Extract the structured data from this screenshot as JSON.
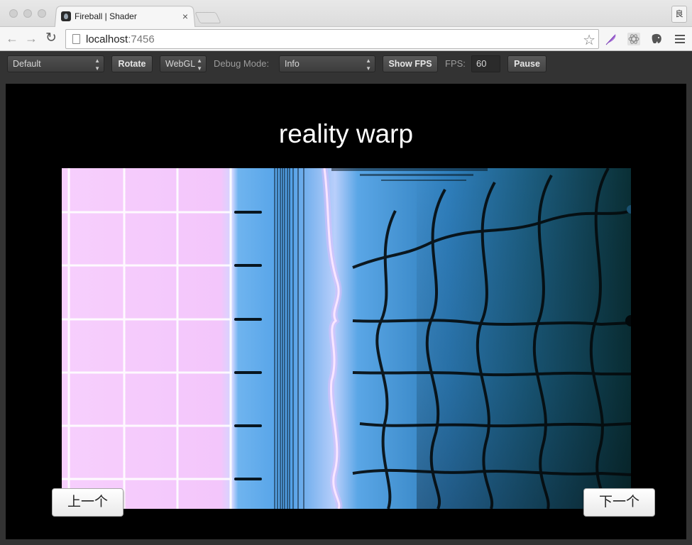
{
  "browser": {
    "tab_title": "Fireball | Shader",
    "tab_close": "×",
    "profile_label": "良",
    "url_host": "localhost",
    "url_port": ":7456"
  },
  "controls": {
    "scene_select": "Default",
    "rotate_label": "Rotate",
    "renderer_select": "WebGL",
    "debug_mode_label": "Debug Mode:",
    "debug_mode_select": "Info",
    "show_fps_label": "Show FPS",
    "fps_label": "FPS:",
    "fps_value": "60",
    "pause_label": "Pause"
  },
  "stage": {
    "title": "reality warp",
    "prev_label": "上一个",
    "next_label": "下一个"
  },
  "colors": {
    "pink": "#f3c2fb",
    "blue": "#3a8fd8",
    "dark_teal": "#0b3540"
  },
  "icons": [
    "back-arrow-icon",
    "forward-arrow-icon",
    "reload-icon",
    "page-icon",
    "star-icon",
    "quill-icon",
    "atom-icon",
    "elephant-icon",
    "menu-icon"
  ]
}
